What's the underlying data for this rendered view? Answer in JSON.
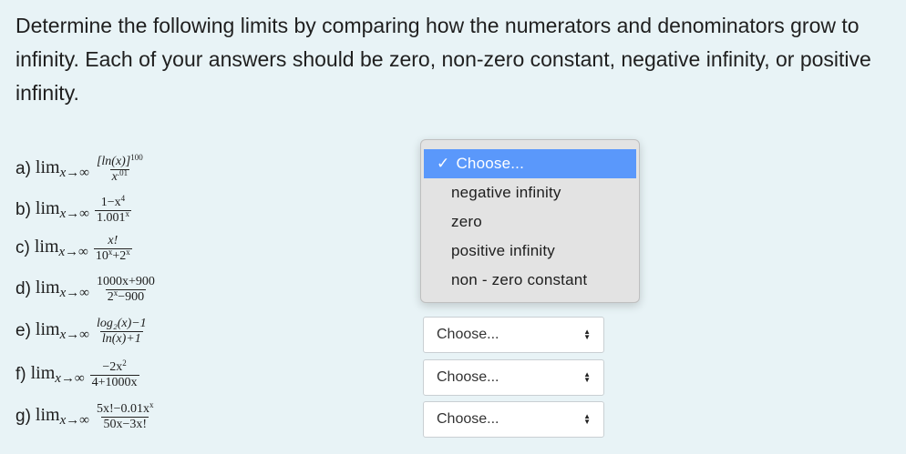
{
  "instructions": "Determine the following limits by comparing how the numerators and denominators grow to infinity. Each of your answers should be zero, non-zero constant, negative infinity, or positive infinity.",
  "lim_word": "lim",
  "lim_sub": "x→∞",
  "problems": [
    {
      "label": "a)",
      "num": "[ln(x)]",
      "num_sup": "100",
      "den": "x",
      "den_sup": ".01"
    },
    {
      "label": "b)",
      "num": "1−x",
      "num_sup": "4",
      "den": "1.001",
      "den_sup": "x"
    },
    {
      "label": "c)",
      "num": "x!",
      "num_sup": "",
      "den": "10",
      "den_sup": "x",
      "den_tail": "+2",
      "den_tail_sup": "x"
    },
    {
      "label": "d)",
      "num": "1000x+900",
      "num_sup": "",
      "den": "2",
      "den_sup": "x",
      "den_tail": "−900"
    },
    {
      "label": "e)",
      "num": "log₂(x)−1",
      "num_sup": "",
      "den": "ln(x)+1",
      "den_sup": ""
    },
    {
      "label": "f)",
      "num": "−2x",
      "num_sup": "2",
      "den": "4+1000x",
      "den_sup": ""
    },
    {
      "label": "g)",
      "num": "5x!−0.01x",
      "num_sup": "x",
      "den": "50x−3x!",
      "den_sup": ""
    }
  ],
  "select_placeholder": "Choose...",
  "dropdown": {
    "check": "✓",
    "options": [
      "Choose...",
      "negative infinity",
      "zero",
      "positive infinity",
      "non - zero constant"
    ],
    "selected_index": 0
  },
  "icons": {
    "select_arrows": "updown-arrows-icon"
  }
}
